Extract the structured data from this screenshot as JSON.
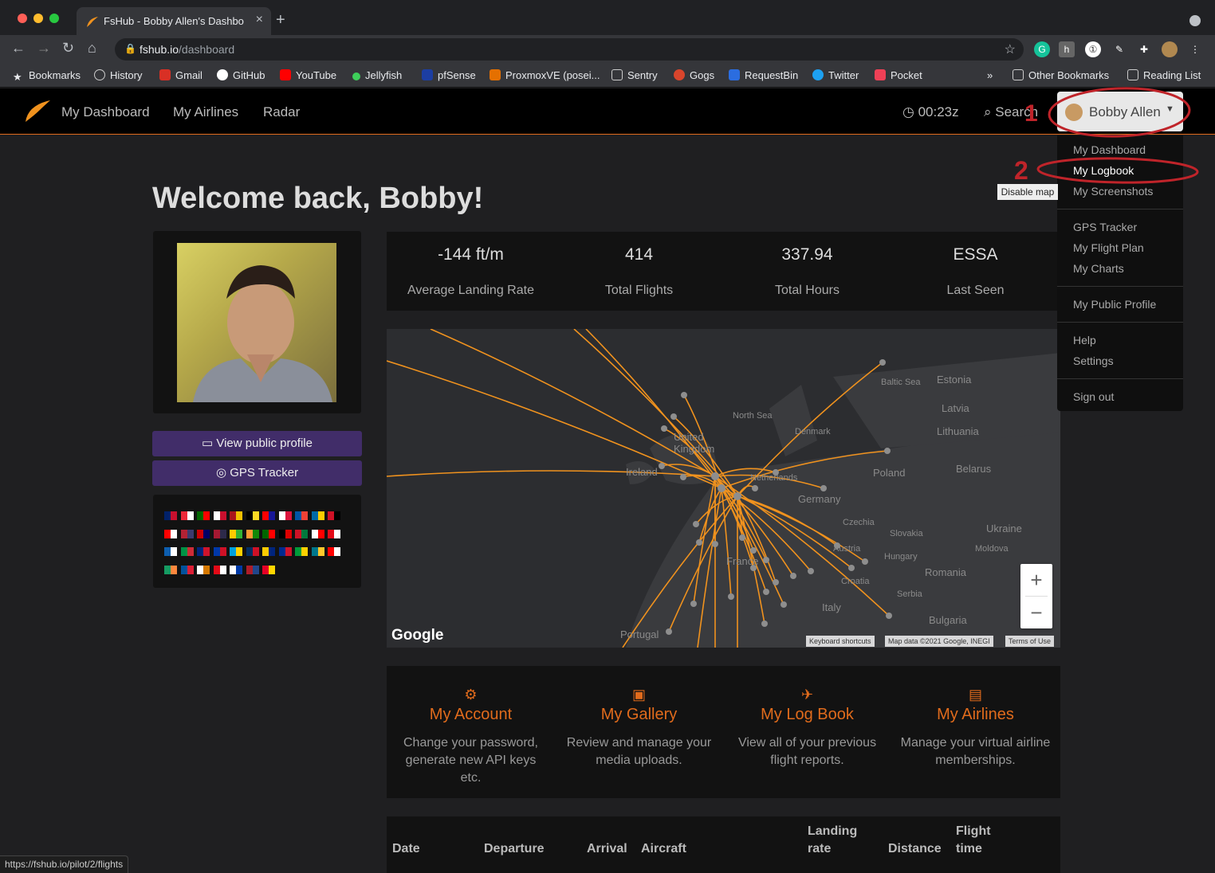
{
  "browser": {
    "tab_title": "FsHub - Bobby Allen's Dashboard",
    "url_host": "fshub.io",
    "url_path": "/dashboard",
    "bookmarks": [
      "Bookmarks",
      "History",
      "Gmail",
      "GitHub",
      "YouTube",
      "Jellyfish",
      "pfSense",
      "ProxmoxVE (posei...",
      "Sentry",
      "Gogs",
      "RequestBin",
      "Twitter",
      "Pocket"
    ],
    "more": "»",
    "other_bookmarks": "Other Bookmarks",
    "reading_list": "Reading List",
    "status_url": "https://fshub.io/pilot/2/flights"
  },
  "nav": {
    "links": [
      "My Dashboard",
      "My Airlines",
      "Radar"
    ],
    "clock": "00:23z",
    "search": "Search",
    "user": "Bobby Allen"
  },
  "dropdown": {
    "group1": [
      "My Dashboard",
      "My Logbook",
      "My Screenshots"
    ],
    "group2": [
      "GPS Tracker",
      "My Flight Plan",
      "My Charts"
    ],
    "group3": [
      "My Public Profile"
    ],
    "group4": [
      "Help",
      "Settings"
    ],
    "group5": [
      "Sign out"
    ]
  },
  "tooltip": "Disable map",
  "annotations": {
    "one": "1",
    "two": "2"
  },
  "welcome": "Welcome back, Bobby!",
  "buttons": {
    "public_profile": "View public profile",
    "gps": "GPS Tracker"
  },
  "stats": [
    {
      "value": "-144 ft/m",
      "label": "Average Landing Rate"
    },
    {
      "value": "414",
      "label": "Total Flights"
    },
    {
      "value": "337.94",
      "label": "Total Hours"
    },
    {
      "value": "ESSA",
      "label": "Last Seen"
    }
  ],
  "map": {
    "labels": [
      "Baltic Sea",
      "Estonia",
      "North Sea",
      "Latvia",
      "Denmark",
      "Lithuania",
      "United Kingdom",
      "Ireland",
      "Netherlands",
      "Poland",
      "Belarus",
      "Germany",
      "Czechia",
      "Slovakia",
      "Ukraine",
      "Austria",
      "Hungary",
      "Moldova",
      "France",
      "Romania",
      "Croatia",
      "Serbia",
      "Italy",
      "Bulgaria",
      "Portugal"
    ],
    "google": "Google",
    "keyboard": "Keyboard shortcuts",
    "mapdata": "Map data ©2021 Google, INEGI",
    "terms": "Terms of Use",
    "zoom_in": "+",
    "zoom_out": "−"
  },
  "cards": [
    {
      "title": "My Account",
      "desc": "Change your password, generate new API keys etc."
    },
    {
      "title": "My Gallery",
      "desc": "Review and manage your media uploads."
    },
    {
      "title": "My Log Book",
      "desc": "View all of your previous flight reports."
    },
    {
      "title": "My Airlines",
      "desc": "Manage your virtual airline memberships."
    }
  ],
  "table_headers": [
    "Date",
    "Departure",
    "Arrival",
    "Aircraft",
    "Landing rate",
    "Distance",
    "Flight time"
  ],
  "colors": {
    "accent": "#e06b1c",
    "purple": "#412d69",
    "route": "#f0921e",
    "annotation": "#c0242a"
  }
}
